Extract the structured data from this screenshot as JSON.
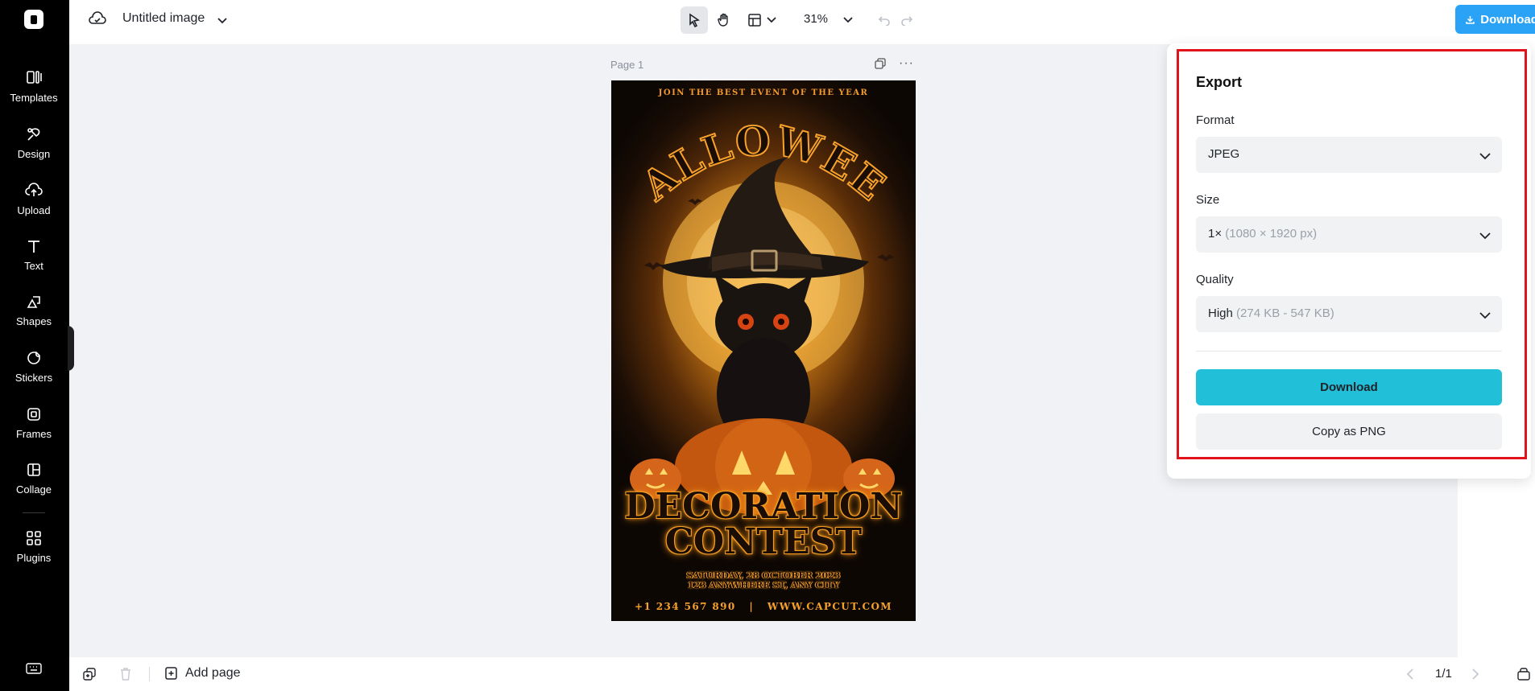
{
  "app": {
    "doc_title": "Untitled image",
    "zoom_level": "31%"
  },
  "sidebar": {
    "items": [
      {
        "label": "Templates",
        "icon": "templates-icon"
      },
      {
        "label": "Design",
        "icon": "design-icon"
      },
      {
        "label": "Upload",
        "icon": "upload-icon"
      },
      {
        "label": "Text",
        "icon": "text-icon"
      },
      {
        "label": "Shapes",
        "icon": "shapes-icon"
      },
      {
        "label": "Stickers",
        "icon": "stickers-icon"
      },
      {
        "label": "Frames",
        "icon": "frames-icon"
      },
      {
        "label": "Collage",
        "icon": "collage-icon"
      },
      {
        "label": "Plugins",
        "icon": "plugins-icon"
      }
    ]
  },
  "toolbar": {
    "download_all_label": "Download all"
  },
  "canvas": {
    "page_label": "Page 1",
    "poster": {
      "tagline": "JOIN THE BEST EVENT OF THE YEAR",
      "headline": "HALLOWEEN",
      "subheadline_1": "DECORATION",
      "subheadline_2": "CONTEST",
      "date": "SATURDAY, 28 OCTOBER 2023",
      "address": "123 ANYWHERE ST, ANY CITY",
      "contact": "+1 234 567 890   |   WWW.CAPCUT.COM"
    }
  },
  "export": {
    "title": "Export",
    "format": {
      "label": "Format",
      "value": "JPEG"
    },
    "size": {
      "label": "Size",
      "value": "1×",
      "detail": "(1080 × 1920 px)"
    },
    "quality": {
      "label": "Quality",
      "value": "High",
      "detail": "(274 KB - 547 KB)"
    },
    "download_label": "Download",
    "copy_label": "Copy as PNG"
  },
  "bottombar": {
    "add_page_label": "Add page",
    "page_counter": "1/1"
  },
  "colors": {
    "accent_blue": "#2aa3f6",
    "download_teal": "#21c0d8",
    "highlight_red": "#e1141b"
  }
}
